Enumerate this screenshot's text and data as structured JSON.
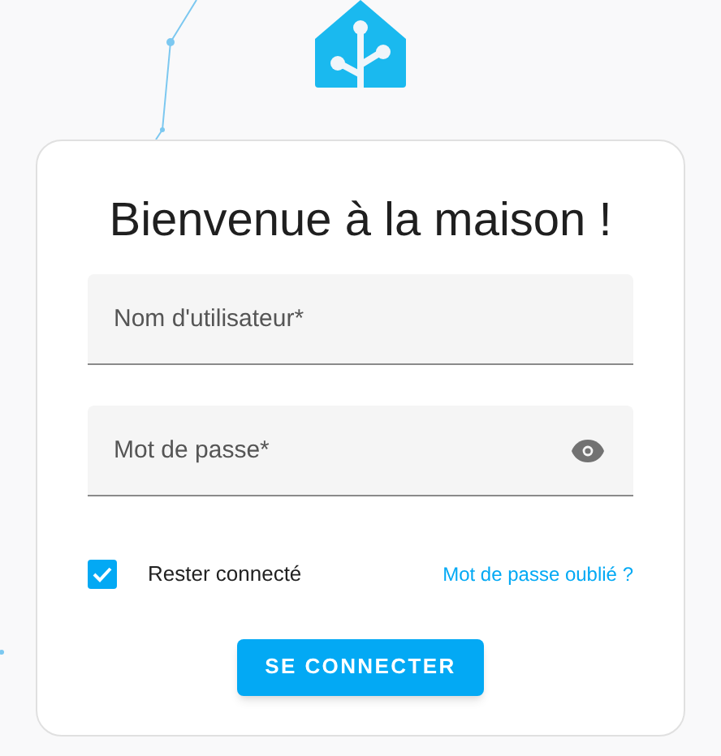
{
  "title": "Bienvenue à la maison !",
  "fields": [
    {
      "placeholder": "Nom d'utilisateur*",
      "kind": "text"
    },
    {
      "placeholder": "Mot de passe*",
      "kind": "password"
    }
  ],
  "remember": {
    "label": "Rester connecté",
    "checked": true
  },
  "forgot_link": "Mot de passe oublié ?",
  "submit_button": "SE CONNECTER"
}
